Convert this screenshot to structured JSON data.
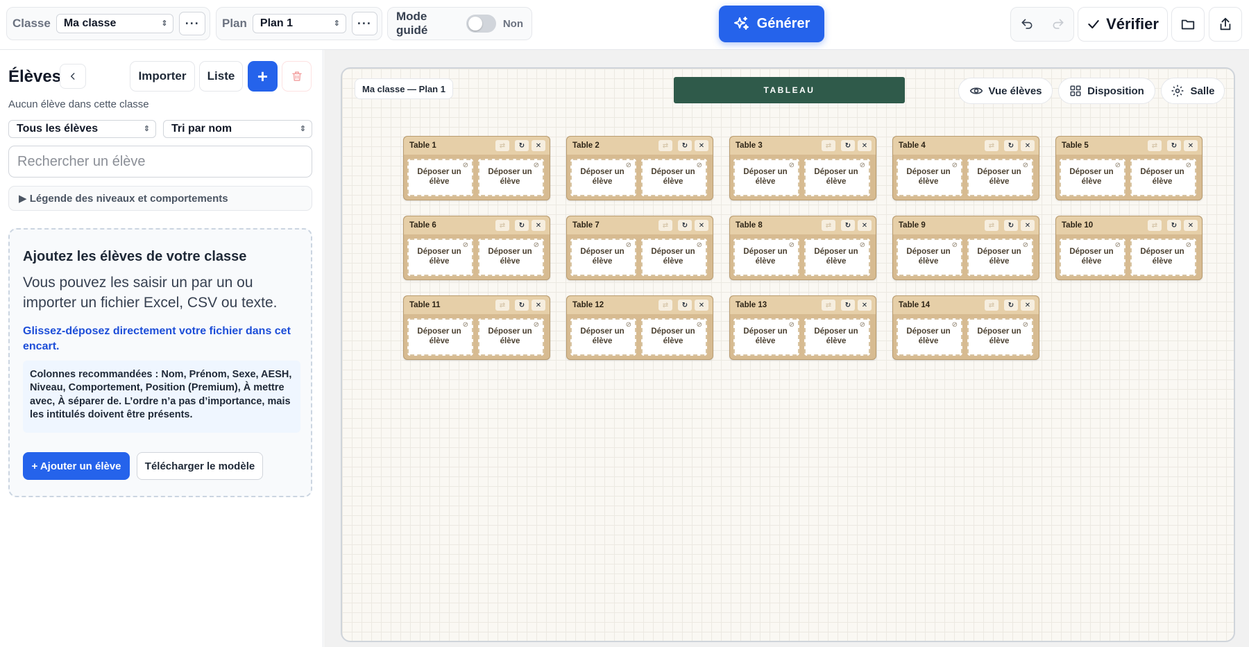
{
  "toolbar": {
    "classe_label": "Classe",
    "classe_value": "Ma classe",
    "plan_label": "Plan",
    "plan_value": "Plan 1",
    "mode_label": "Mode guidé",
    "mode_value": "Non",
    "generate_label": "Générer",
    "verify_label": "Vérifier"
  },
  "sidebar": {
    "title": "Élèves",
    "import_label": "Importer",
    "list_label": "Liste",
    "add_label": "+",
    "empty_text": "Aucun élève dans cette classe",
    "filter_value": "Tous les élèves",
    "sort_value": "Tri par nom",
    "search_placeholder": "Rechercher un élève",
    "legend_label": "▶ Légende des niveaux et comportements",
    "dropzone": {
      "title": "Ajoutez les élèves de votre classe",
      "text": "Vous pouvez les saisir un par un ou importer un fichier Excel, CSV ou texte.",
      "drop_hint": "Glissez-déposez directement votre fichier dans cet encart.",
      "columns": "Colonnes recommandées : Nom, Prénom, Sexe, AESH, Niveau, Comportement, Position (Premium), À mettre avec, À séparer de. L’ordre n’a pas d’importance, mais les intitulés doivent être présents.",
      "add_student": "+ Ajouter un élève",
      "download_template": "Télécharger le modèle"
    }
  },
  "room": {
    "plan_chip": "Ma classe — Plan 1",
    "board_label": "TABLEAU",
    "view_label": "Vue élèves",
    "layout_label": "Disposition",
    "room_label": "Salle",
    "seat_label": "Déposer un élève",
    "desks": [
      {
        "name": "Table 1"
      },
      {
        "name": "Table 2"
      },
      {
        "name": "Table 3"
      },
      {
        "name": "Table 4"
      },
      {
        "name": "Table 5"
      },
      {
        "name": "Table 6"
      },
      {
        "name": "Table 7"
      },
      {
        "name": "Table 8"
      },
      {
        "name": "Table 9"
      },
      {
        "name": "Table 10"
      },
      {
        "name": "Table 11"
      },
      {
        "name": "Table 12"
      },
      {
        "name": "Table 13"
      },
      {
        "name": "Table 14"
      }
    ]
  },
  "icons": [
    "more-icon",
    "undo-icon",
    "redo-icon",
    "check-icon",
    "folder-icon",
    "share-icon",
    "sparkles-icon",
    "chevron-left-icon",
    "trash-icon",
    "eye-icon",
    "grid-icon",
    "gear-icon",
    "swap-icon",
    "refresh-icon",
    "close-icon",
    "pin-icon"
  ],
  "colors": {
    "accent": "#2563eb",
    "board": "#2f5a4a",
    "desk": "#d7bb91",
    "danger": "#ef4444"
  }
}
